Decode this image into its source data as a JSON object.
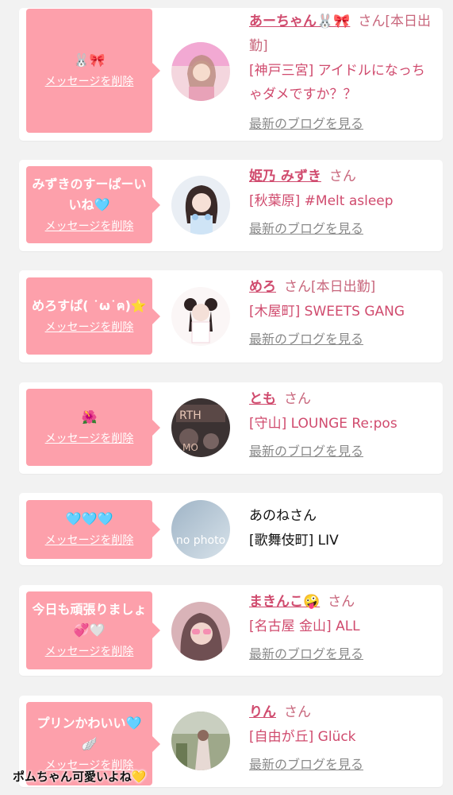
{
  "cards": [
    {
      "bubble": "🐰🎀",
      "delete_label": "メッセージを削除",
      "name": "あーちゃん🐰🎀",
      "san": "さん",
      "status": "[本日出勤]",
      "shop": "[神戸三宮] アイドルになっちゃダメですか？？",
      "blog_label": "最新のブログを見る"
    },
    {
      "bubble": "みずきのすーぱーいいね🩵",
      "delete_label": "メッセージを削除",
      "name": "姫乃 みずき",
      "san": "さん",
      "status": "",
      "shop": "[秋葉原] #Melt asleep",
      "blog_label": "最新のブログを見る"
    },
    {
      "bubble": "めろすぱ( ˙ω˙ฅ)⭐️",
      "delete_label": "メッセージを削除",
      "name": "めろ",
      "san": "さん",
      "status": "[本日出勤]",
      "shop": "[木屋町] SWEETS GANG",
      "blog_label": "最新のブログを見る"
    },
    {
      "bubble": "🌺",
      "delete_label": "メッセージを削除",
      "name": "とも",
      "san": "さん",
      "status": "",
      "shop": "[守山] LOUNGE Re:pos",
      "blog_label": "最新のブログを見る"
    },
    {
      "bubble": "🩵🩵🩵",
      "delete_label": "メッセージを削除",
      "name": "あのね",
      "san": "さん",
      "status": "",
      "shop": "[歌舞伎町] LIV",
      "blog_label": "",
      "avatar_text": "no photo"
    },
    {
      "bubble": "今日も頑張りましょ💞🤍",
      "delete_label": "メッセージを削除",
      "name": "まきんこ🤪",
      "san": "さん",
      "status": "",
      "shop": "[名古屋 金山] ALL",
      "blog_label": "最新のブログを見る"
    },
    {
      "bubble": "プリンかわいい🩵🪽",
      "delete_label": "メッセージを削除",
      "name": "りん",
      "san": "さん",
      "status": "",
      "shop": "[自由が丘] Glück",
      "blog_label": "最新のブログを見る"
    }
  ],
  "overlay_caption": "ポムちゃん可愛いよね💛",
  "colors": {
    "background": "#f2f2f2",
    "bubble": "#fda0ab",
    "name": "#d04b6e",
    "link_gray": "#8a8a8a"
  }
}
